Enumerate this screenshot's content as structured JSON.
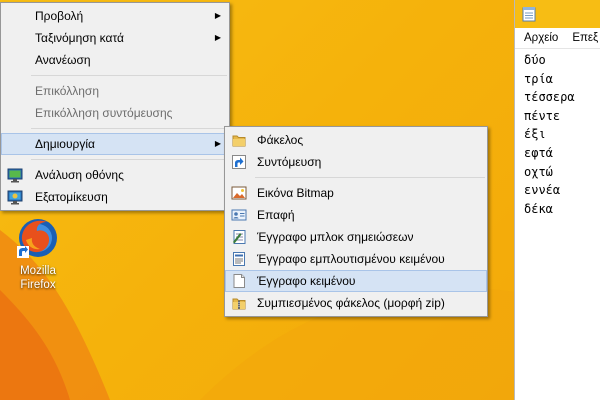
{
  "desktop": {
    "icons": [
      {
        "label_line1": "Mozilla",
        "label_line2": "Firefox",
        "icon": "firefox-icon"
      }
    ]
  },
  "context_menu": {
    "items": [
      {
        "label": "Προβολή",
        "has_submenu": true
      },
      {
        "label": "Ταξινόμηση κατά",
        "has_submenu": true
      },
      {
        "label": "Ανανέωση"
      },
      {
        "label": "Επικόλληση",
        "disabled": true
      },
      {
        "label": "Επικόλληση συντόμευσης",
        "disabled": true
      },
      {
        "label": "Δημιουργία",
        "has_submenu": true,
        "highlighted": true
      },
      {
        "label": "Ανάλυση οθόνης",
        "icon": "display-settings-icon"
      },
      {
        "label": "Εξατομίκευση",
        "icon": "personalize-icon"
      }
    ]
  },
  "new_submenu": {
    "items": [
      {
        "label": "Φάκελος",
        "icon": "folder-icon"
      },
      {
        "label": "Συντόμευση",
        "icon": "shortcut-icon"
      },
      {
        "label": "Εικόνα Bitmap",
        "icon": "bitmap-icon"
      },
      {
        "label": "Επαφή",
        "icon": "contact-icon"
      },
      {
        "label": "Έγγραφο μπλοκ σημειώσεων",
        "icon": "journal-document-icon"
      },
      {
        "label": "Έγγραφο εμπλουτισμένου κειμένου",
        "icon": "rich-text-icon"
      },
      {
        "label": "Έγγραφο κειμένου",
        "icon": "text-document-icon",
        "highlighted": true
      },
      {
        "label": "Συμπιεσμένος φάκελος (μορφή zip)",
        "icon": "zip-folder-icon"
      }
    ]
  },
  "notepad": {
    "menu": [
      "Αρχείο",
      "Επεξ"
    ],
    "lines": [
      "δύο",
      "τρία",
      "τέσσερα",
      "πέντε",
      "έξι",
      "εφτά",
      "οχτώ",
      "εννέα",
      "δέκα"
    ]
  },
  "colors": {
    "desktop": "#f5b40c",
    "menu_bg": "#f0f0f0",
    "highlight": "#d5e3f4",
    "highlight_border": "#a9c4e8"
  }
}
